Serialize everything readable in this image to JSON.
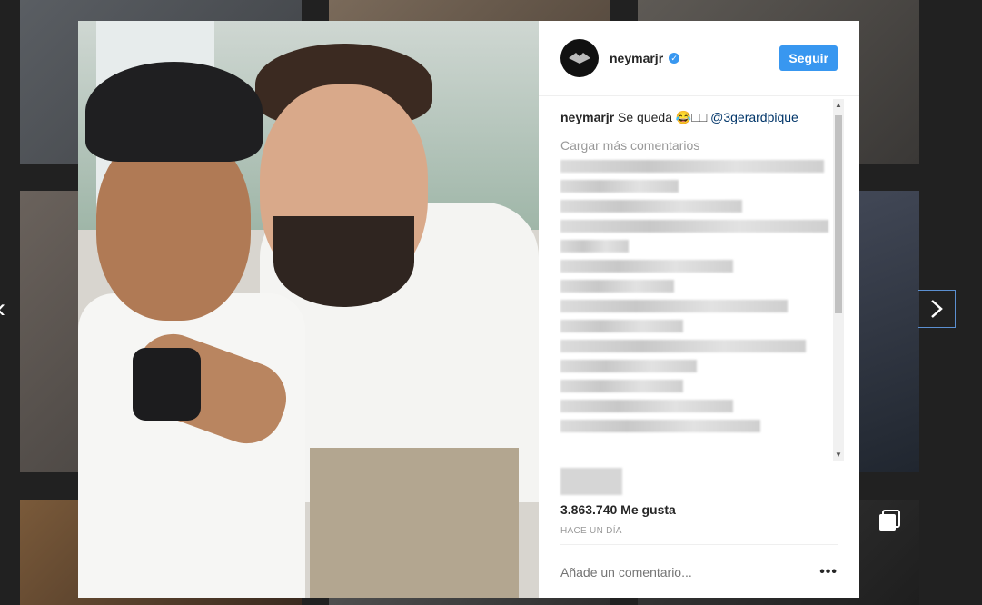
{
  "post": {
    "username": "neymarjr",
    "follow_label": "Seguir",
    "caption_user": "neymarjr",
    "caption_text": "Se queda 😂□□",
    "caption_mention": "@3gerardpique",
    "load_more": "Cargar más comentarios",
    "likes": "3.863.740 Me gusta",
    "time": "HACE UN DÍA",
    "comment_placeholder": "Añade un comentario...",
    "options_label": "•••"
  },
  "icons": {
    "verified": "verified-badge-icon",
    "next": "chevron-right-icon",
    "prev": "chevron-left-icon",
    "options": "more-options-icon",
    "multi": "multiple-posts-icon"
  },
  "colors": {
    "accent": "#3897f0",
    "mention": "#003569"
  }
}
